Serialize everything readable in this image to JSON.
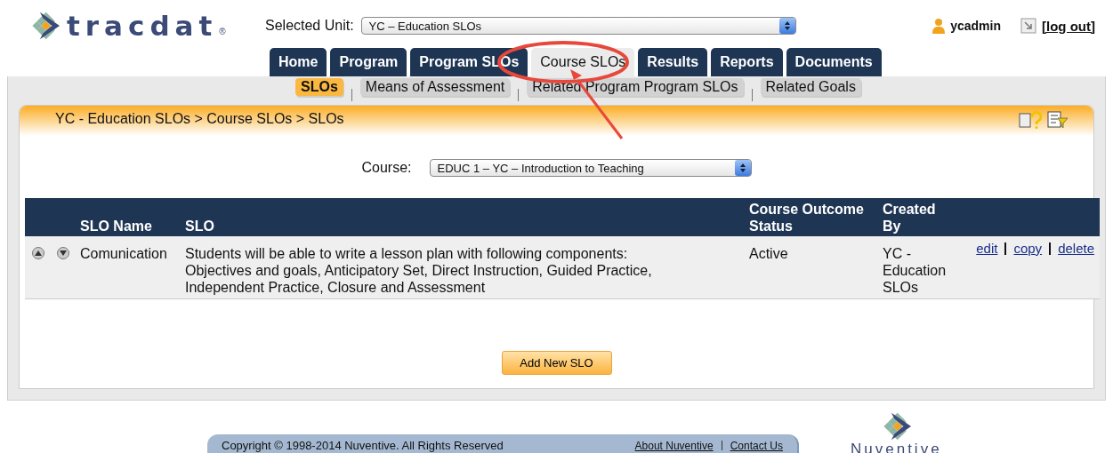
{
  "header": {
    "logo": "tracdat",
    "logo_mark": "®",
    "unit_label": "Selected Unit:",
    "unit_value": "YC – Education SLOs",
    "user": "ycadmin",
    "logout": "[log out]"
  },
  "tabs": [
    {
      "label": "Home",
      "selected": false
    },
    {
      "label": "Program",
      "selected": false
    },
    {
      "label": "Program SLOs",
      "selected": false
    },
    {
      "label": "Course SLOs",
      "selected": true
    },
    {
      "label": "Results",
      "selected": false
    },
    {
      "label": "Reports",
      "selected": false
    },
    {
      "label": "Documents",
      "selected": false
    }
  ],
  "subtabs": [
    {
      "label": "SLOs",
      "selected": true
    },
    {
      "label": "Means of Assessment",
      "selected": false
    },
    {
      "label": "Related Program Program SLOs",
      "selected": false
    },
    {
      "label": "Related Goals",
      "selected": false
    }
  ],
  "panel": {
    "breadcrumb": "YC - Education SLOs > Course SLOs > SLOs",
    "course_label": "Course:",
    "course_value": "EDUC 1 – YC – Introduction to Teaching"
  },
  "table": {
    "columns": [
      "SLO Name",
      "SLO",
      "Course Outcome Status",
      "Created By"
    ],
    "rows": [
      {
        "name": "Comunication",
        "slo": "Students will be able to write a lesson plan with following components: Objectives and goals, Anticipatory Set, Direct Instruction, Guided Practice, Independent Practice, Closure and  Assessment",
        "status": "Active",
        "created_by": "YC - Education SLOs",
        "actions": [
          "edit",
          "copy",
          "delete"
        ]
      }
    ]
  },
  "add_button": "Add New SLO",
  "footer": {
    "copyright": "Copyright © 1998-2014 Nuventive. All Rights Reserved",
    "links": [
      "About Nuventive",
      "Contact Us"
    ],
    "brand": "Nuventive"
  }
}
